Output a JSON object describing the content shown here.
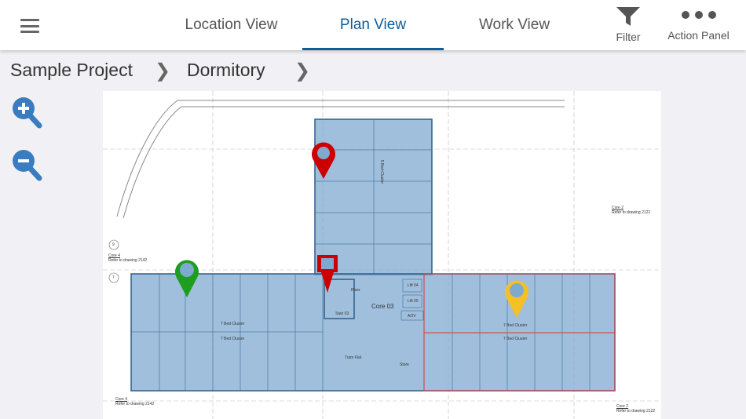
{
  "header": {
    "tabs": [
      {
        "label": "Location View",
        "active": false
      },
      {
        "label": "Plan View",
        "active": true
      },
      {
        "label": "Work View",
        "active": false
      }
    ],
    "filter_label": "Filter",
    "action_panel_label": "Action Panel",
    "accent": "#0d5c99"
  },
  "breadcrumb": [
    "Sample Project",
    "Dormitory"
  ],
  "plan": {
    "core_label": "Core 03",
    "clusters": [
      "7 Bed Cluster",
      "7 Bed Cluster",
      "7 Bed Cluster",
      "7 Bed Cluster",
      "5 Bed Cluster"
    ],
    "rooms": {
      "stair": "Stair 03",
      "riser": "Riser",
      "lift1": "Lift 04",
      "lift2": "Lift 05",
      "aov": "AOV",
      "tutor": "Tutor Flat",
      "store": "Store"
    },
    "grid": [
      "9",
      "7"
    ],
    "refs": [
      {
        "title": "Core 4",
        "text": "Refer to drawing 2142"
      },
      {
        "title": "Core 4",
        "text": "Refer to drawing 2142"
      },
      {
        "title": "Core 2",
        "text": "Refer to drawing 2122"
      },
      {
        "title": "Core 2",
        "text": "Refer to drawing 2122"
      }
    ],
    "pins": [
      {
        "type": "location",
        "color": "#cc0000"
      },
      {
        "type": "square",
        "color": "#cc0000"
      },
      {
        "type": "location",
        "color": "#1e9e1e"
      },
      {
        "type": "location",
        "color": "#f5c027"
      }
    ]
  }
}
